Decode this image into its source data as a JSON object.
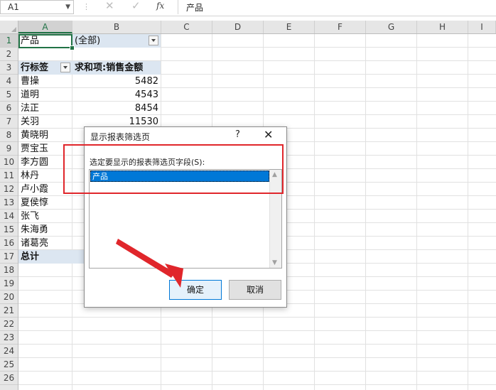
{
  "formula_bar": {
    "name_box": "A1",
    "fx_label": "fx",
    "content": "产品"
  },
  "columns": [
    "A",
    "B",
    "C",
    "D",
    "E",
    "F",
    "G",
    "H",
    "I"
  ],
  "rows": [
    "1",
    "2",
    "3",
    "4",
    "5",
    "6",
    "7",
    "8",
    "9",
    "10",
    "11",
    "12",
    "13",
    "14",
    "15",
    "16",
    "17",
    "18",
    "19",
    "20",
    "21",
    "22",
    "23",
    "24",
    "25",
    "26"
  ],
  "sheet": {
    "filter_label": "产品",
    "filter_value": "(全部)",
    "row_labels_header": "行标签",
    "sum_header": "求和项:销售金额",
    "data": [
      {
        "name": "曹操",
        "value": "5482"
      },
      {
        "name": "道明",
        "value": "4543"
      },
      {
        "name": "法正",
        "value": "8454"
      },
      {
        "name": "关羽",
        "value": "11530"
      },
      {
        "name": "黄晓明",
        "value": ""
      },
      {
        "name": "贾宝玉",
        "value": ""
      },
      {
        "name": "李方圆",
        "value": ""
      },
      {
        "name": "林丹",
        "value": ""
      },
      {
        "name": "卢小霞",
        "value": ""
      },
      {
        "name": "夏侯惇",
        "value": ""
      },
      {
        "name": "张飞",
        "value": ""
      },
      {
        "name": "朱海勇",
        "value": ""
      },
      {
        "name": "诸葛亮",
        "value": ""
      }
    ],
    "total_label": "总计"
  },
  "dialog": {
    "title": "显示报表筛选页",
    "help": "?",
    "close": "✕",
    "label": "选定要显示的报表筛选页字段(S):",
    "items": [
      "产品"
    ],
    "ok": "确定",
    "cancel": "取消"
  },
  "colors": {
    "accent": "#217346",
    "selection": "#0078d7",
    "annotation_red": "#e0262b",
    "pivot_header_bg": "#dce6f1"
  }
}
